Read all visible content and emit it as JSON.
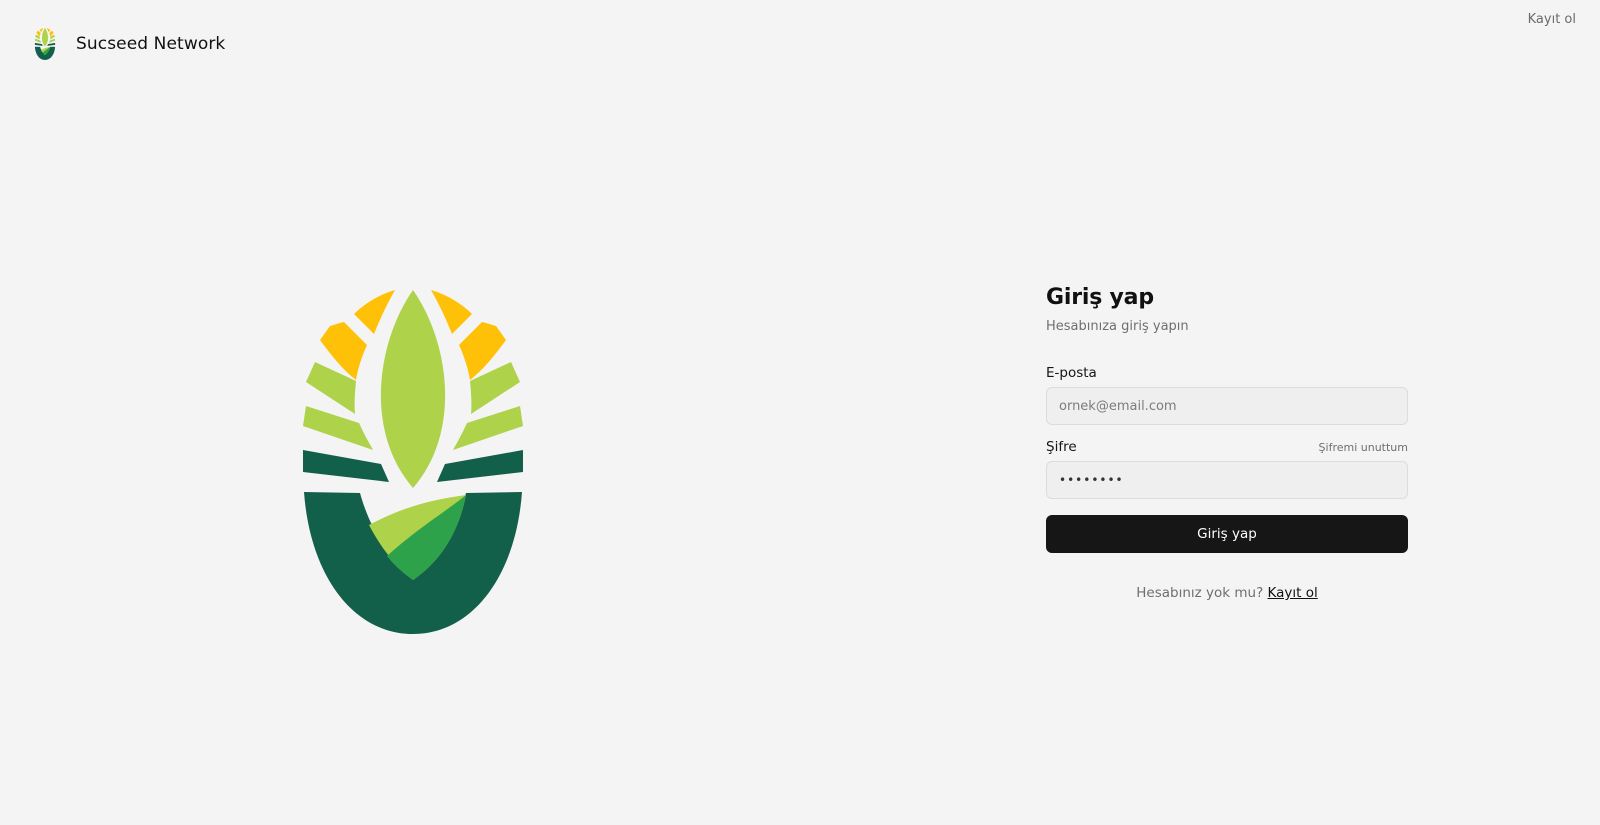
{
  "header": {
    "brand_name": "Sucseed Network",
    "signup_link": "Kayıt ol"
  },
  "login": {
    "title": "Giriş yap",
    "subtitle": "Hesabınıza giriş yapın",
    "email_label": "E-posta",
    "email_placeholder": "ornek@email.com",
    "password_label": "Şifre",
    "forgot_link": "Şifremi unuttum",
    "password_value": "••••••••",
    "submit_label": "Giriş yap",
    "no_account_text": "Hesabınız yok mu?",
    "signup_link": "Kayıt ol"
  },
  "icons": {
    "brand_logo": "sucseed-logo-icon",
    "hero_logo": "sucseed-logo-icon"
  },
  "colors": {
    "background": "#f4f4f4",
    "logo_yellow": "#ffc107",
    "logo_light_green": "#aed24a",
    "logo_green": "#2ea24a",
    "logo_dark_green": "#13604a",
    "button": "#161616"
  }
}
